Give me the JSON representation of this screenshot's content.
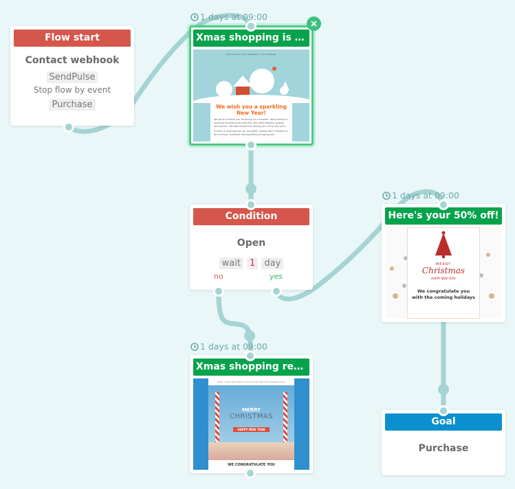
{
  "canvas": {
    "background": "#e9f7f8",
    "connector_color": "#a6d3d4"
  },
  "nodes": {
    "flow_start": {
      "header": "Flow start",
      "header_color": "#d5574c",
      "trigger": "Contact webhook",
      "source_tag": "SendPulse",
      "stop_label": "Stop flow by event",
      "stop_event_tag": "Purchase"
    },
    "email_1": {
      "schedule": "1 days at 09:00",
      "header": "Xmas shopping is on!",
      "header_color": "#07a34c",
      "selected": true,
      "preview": {
        "description": "Describe your email campaign in short message.",
        "headline": "We wish you a sparkling New Year!",
        "body_1": "We want to thank you for being our customer. We promise to continue providing you with the very best designs, quality, and service. We look forward to seeing you in the new year.",
        "body_2": "If there is anything we can do better, please don't hesitate to let us know: customer-manager@mycompany.com"
      }
    },
    "condition": {
      "header": "Condition",
      "header_color": "#d5574c",
      "event": "Open",
      "wait_label": "wait",
      "wait_value": "1",
      "wait_unit": "day",
      "branch_no": "no",
      "branch_yes": "yes"
    },
    "email_2": {
      "schedule": "1 days at 09:00",
      "header": "Here's your 50% off!",
      "header_color": "#07a34c",
      "preview": {
        "merry": "MERRY",
        "christmas": "Christmas",
        "happy": "HAPPY NEW YEAR",
        "headline": "We congratulate you with the coming holidays"
      }
    },
    "email_3": {
      "schedule": "1 days at 09:00",
      "header": "Xmas shopping remi...",
      "header_color": "#07a34c",
      "preview": {
        "description": "Enter a short description of your email. View this message online",
        "merry": "MERRY",
        "christmas": "CHRISTMAS",
        "happy": "HAPPY NEW YEAR",
        "footer": "WE CONGRATULATE YOU"
      }
    },
    "goal": {
      "header": "Goal",
      "header_color": "#0b90cf",
      "event": "Purchase"
    }
  }
}
